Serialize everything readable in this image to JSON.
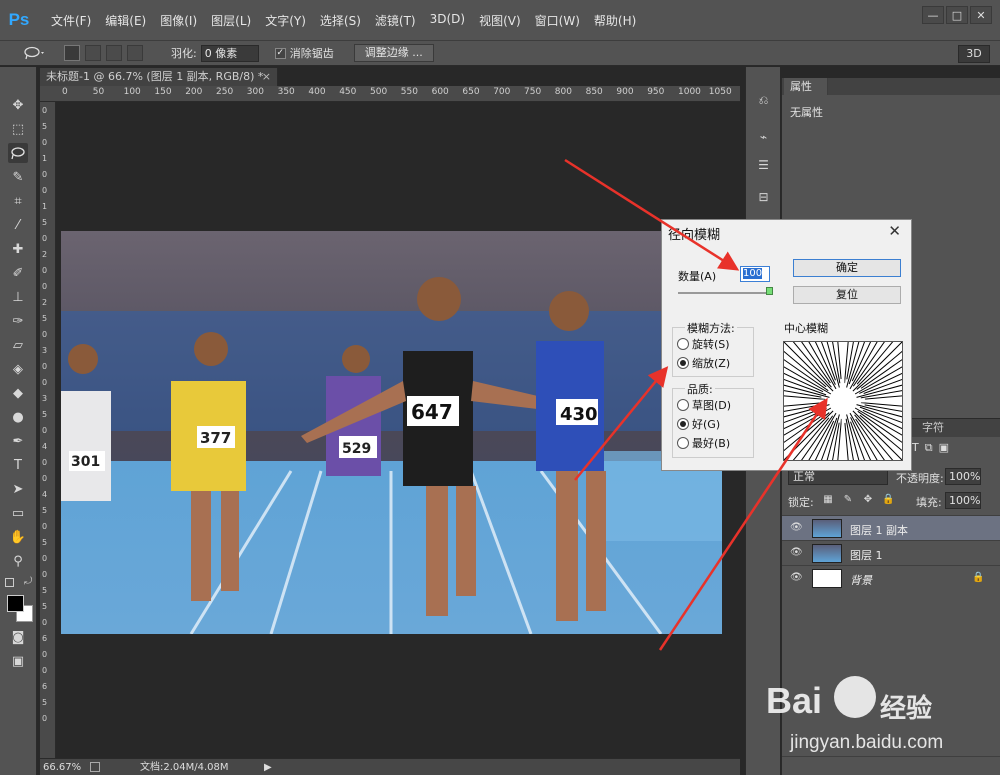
{
  "app": {
    "logo": "Ps",
    "menu": [
      "文件(F)",
      "编辑(E)",
      "图像(I)",
      "图层(L)",
      "文字(Y)",
      "选择(S)",
      "滤镜(T)",
      "3D(D)",
      "视图(V)",
      "窗口(W)",
      "帮助(H)"
    ],
    "window_buttons": [
      "—",
      "□",
      "✕"
    ]
  },
  "options": {
    "feather_label": "羽化:",
    "feather_value": "0 像素",
    "antialias_label": "消除锯齿",
    "antialias_checked": "✓",
    "refine_edge": "调整边缘 ...",
    "mode_3d": "3D"
  },
  "document": {
    "tab_title": "未标题-1 @ 66.7% (图层 1 副本, RGB/8) *",
    "tab_close": "×",
    "ruler_ticks": [
      "0",
      "50",
      "100",
      "150",
      "200",
      "250",
      "300",
      "350",
      "400",
      "450",
      "500",
      "550",
      "600",
      "650",
      "700",
      "750",
      "800",
      "850",
      "900",
      "950",
      "1000",
      "1050"
    ],
    "vruler_ticks": [
      "0",
      "5",
      "0",
      "1",
      "0",
      "0",
      "1",
      "5",
      "0",
      "2",
      "0",
      "0",
      "2",
      "5",
      "0",
      "3",
      "0",
      "0",
      "3",
      "5",
      "0",
      "4",
      "0",
      "0",
      "4",
      "5",
      "0",
      "5",
      "0",
      "0",
      "5",
      "5",
      "0",
      "6",
      "0",
      "0",
      "6",
      "5",
      "0"
    ]
  },
  "status": {
    "zoom": "66.67%",
    "doc_size": "文档:2.04M/4.08M",
    "arrow": "▶"
  },
  "photo_bibs": [
    "301",
    "377",
    "647",
    "430",
    "529"
  ],
  "properties": {
    "tab": "属性",
    "content": "无属性"
  },
  "layers": {
    "tabs": [
      "字符"
    ],
    "blend_mode": "正常",
    "opacity_label": "不透明度:",
    "opacity_value": "100%",
    "lock_label": "锁定:",
    "fill_label": "填充:",
    "fill_value": "100%",
    "items": [
      {
        "name": "图层 1 副本"
      },
      {
        "name": "图层 1"
      },
      {
        "name": "背景"
      }
    ]
  },
  "dialog": {
    "title": "径向模糊",
    "close": "✕",
    "amount_label": "数量(A)",
    "amount_value": "100",
    "ok": "确定",
    "reset": "复位",
    "blur_method_title": "模糊方法:",
    "blur_methods": [
      "旋转(S)",
      "缩放(Z)"
    ],
    "quality_title": "品质:",
    "qualities": [
      "草图(D)",
      "好(G)",
      "最好(B)"
    ],
    "center_label": "中心模糊"
  },
  "watermark": {
    "brand": "Bai",
    "cn": "经验",
    "url": "jingyan.baidu.com"
  },
  "colors": {
    "accent": "#31a8ff",
    "arrow": "#e8322a",
    "selected_layer": "#6c7282"
  }
}
